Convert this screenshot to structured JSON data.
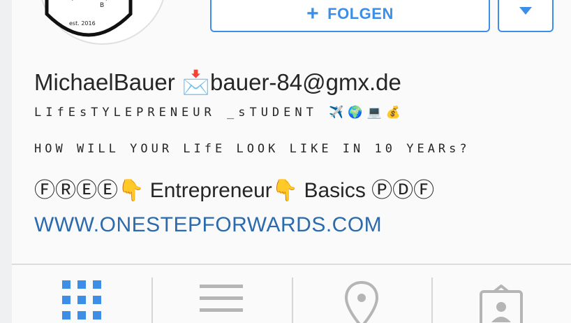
{
  "profile": {
    "crest_letter": "B",
    "crest_text": "est. 2016"
  },
  "actions": {
    "follow_plus": "+",
    "follow_label": "FOLGEN"
  },
  "bio": {
    "line1": "MichaelBauer 📩bauer-84@gmx.de",
    "line2": "LIfEsTYLEPRENEUR _sTUDENT ✈️🌍💻💰",
    "line3": "HOW WILL YOUR LIfE LOOK LIKE IN 10 YEARs?",
    "line4": "ⒻⓇⒺⒺ👇 Entrepreneur👇 Basics ⓅⒹⒻ",
    "website": "WWW.ONESTEPFORWARDS.COM"
  },
  "tabs": [
    {
      "icon": "grid-icon",
      "active": true
    },
    {
      "icon": "list-icon",
      "active": false
    },
    {
      "icon": "location-pin-icon",
      "active": false
    },
    {
      "icon": "tagged-photos-icon",
      "active": false
    }
  ],
  "colors": {
    "accent": "#3d8ee6",
    "link": "#2b6aad",
    "inactive_icon": "#b5b5b5"
  }
}
